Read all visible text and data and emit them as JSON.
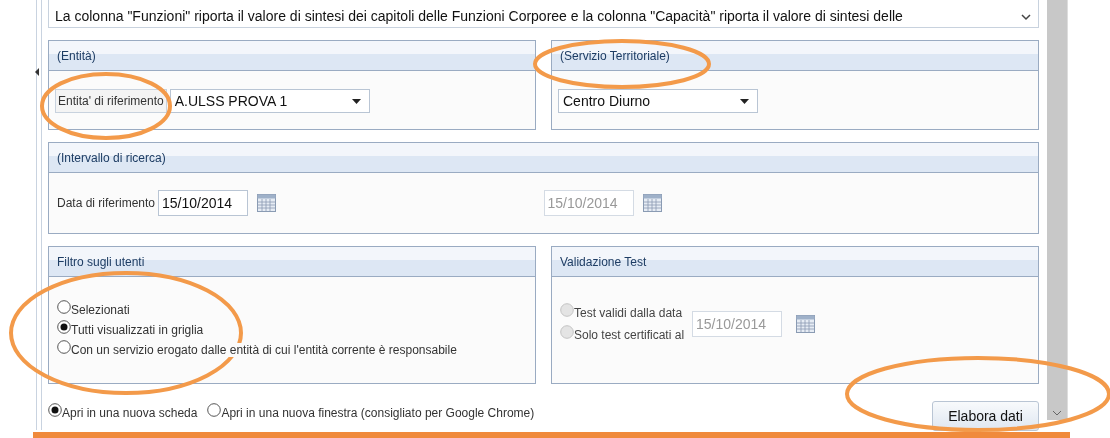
{
  "note_field": {
    "value": "La colonna \"Funzioni\" riporta il valore di sintesi dei capitoli delle Funzioni Corporee e la colonna \"Capacità\" riporta il valore di sintesi delle"
  },
  "entity_panel": {
    "title": "(Entità)",
    "label": "Entita' di riferimento",
    "select_value": "A.ULSS PROVA 1"
  },
  "service_panel": {
    "title": "(Servizio Territoriale)",
    "select_value": "Centro Diurno"
  },
  "interval_panel": {
    "title": "(Intervallo di ricerca)",
    "label": "Data di riferimento",
    "date_value": "15/10/2014",
    "second_date": {
      "value": "15/10/2014",
      "disabled": true
    }
  },
  "user_filter_panel": {
    "title": "Filtro sugli utenti",
    "options": [
      {
        "label": "Selezionati",
        "selected": false
      },
      {
        "label": "Tutti visualizzati in griglia",
        "selected": true
      },
      {
        "label": "Con un servizio erogato dalle entità di cui l'entità corrente è responsabile",
        "selected": false
      }
    ]
  },
  "validation_panel": {
    "title": "Validazione Test",
    "options": [
      {
        "label": "Test validi dalla data",
        "selected": false,
        "disabled": true
      },
      {
        "label": "Solo test certificati al",
        "selected": false,
        "disabled": true
      }
    ],
    "date": {
      "value": "15/10/2014",
      "disabled": true
    }
  },
  "open_options": [
    {
      "label": "Apri in una nuova scheda",
      "selected": true
    },
    {
      "label": "Apri in una nuova finestra (consigliato per Google Chrome)",
      "selected": false
    }
  ],
  "submit_button": "Elabora dati"
}
